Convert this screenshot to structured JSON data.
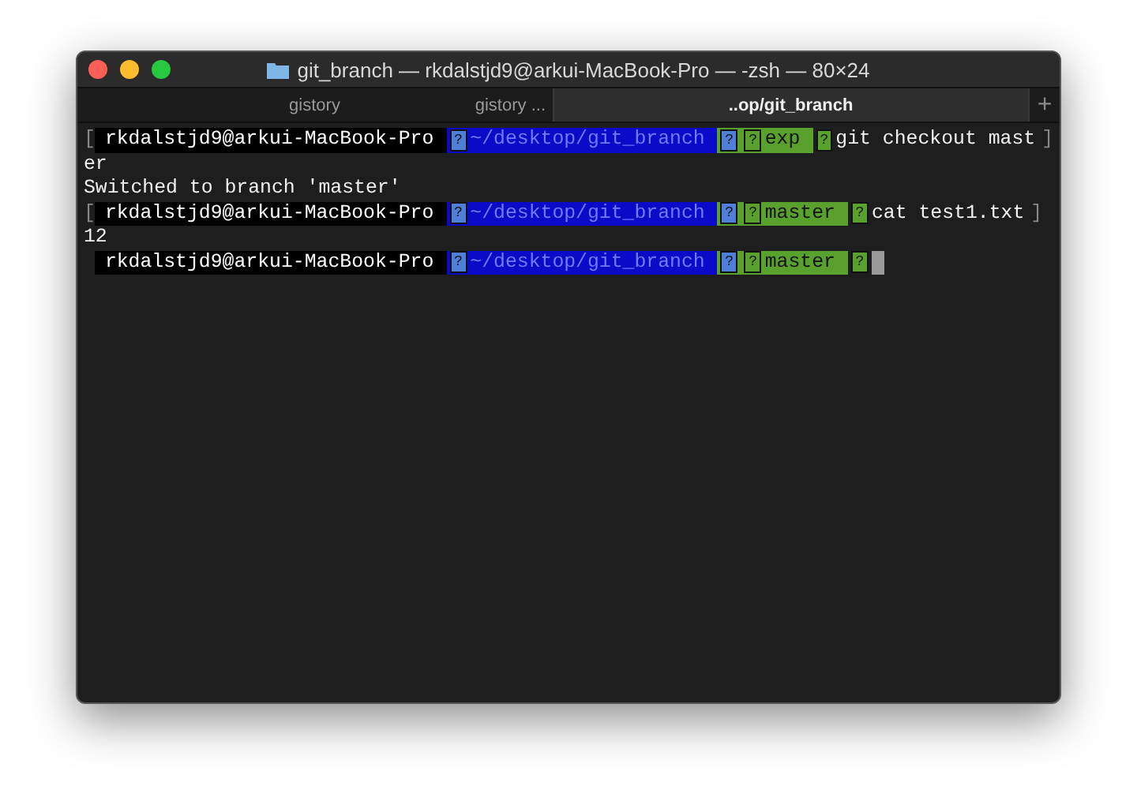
{
  "window": {
    "title": "git_branch — rkdalstjd9@arkui-MacBook-Pro — -zsh — 80×24"
  },
  "tabs": [
    {
      "label": "gistory",
      "detail": "gistory ...",
      "selected": false
    },
    {
      "label": "..op/git_branch",
      "selected": true
    }
  ],
  "new_tab": "+",
  "terminal": {
    "lines": [
      {
        "kind": "prompt",
        "edge": "[",
        "user": "rkdalstjd9@arkui-MacBook-Pro",
        "path_glyph": "?",
        "path": "~/desktop/git_branch",
        "branch_glyphs": [
          "?",
          "?"
        ],
        "branch": "exp",
        "end_glyph": "?",
        "command": "git checkout mast",
        "tail": "]"
      },
      {
        "kind": "output",
        "text": "er"
      },
      {
        "kind": "output",
        "text": "Switched to branch 'master'"
      },
      {
        "kind": "prompt",
        "edge": "[",
        "user": "rkdalstjd9@arkui-MacBook-Pro",
        "path_glyph": "?",
        "path": "~/desktop/git_branch",
        "branch_glyphs": [
          "?",
          "?"
        ],
        "branch": "master",
        "end_glyph": "?",
        "command": "cat test1.txt",
        "tail": "]"
      },
      {
        "kind": "output",
        "text": "12"
      },
      {
        "kind": "prompt",
        "user": "rkdalstjd9@arkui-MacBook-Pro",
        "path_glyph": "?",
        "path": "~/desktop/git_branch",
        "branch_glyphs": [
          "?",
          "?"
        ],
        "branch": "master",
        "end_glyph": "?",
        "cursor": true
      }
    ]
  }
}
